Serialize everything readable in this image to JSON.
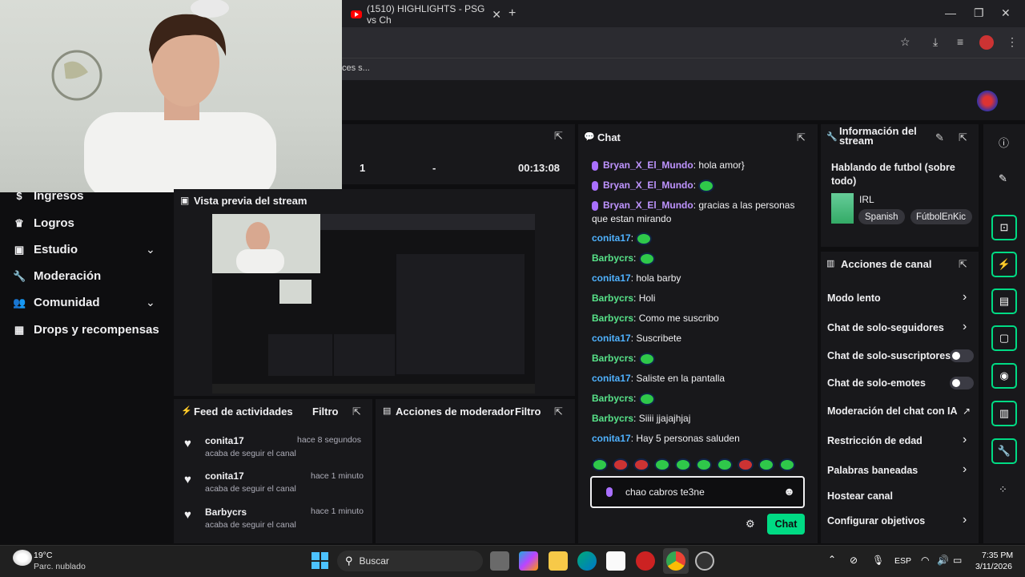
{
  "browser": {
    "tab_title": "(1510) HIGHLIGHTS - PSG vs Ch",
    "bookmarks_partial": "ces s..."
  },
  "stats": {
    "viewers": "1",
    "followers": "-",
    "uptime": "00:13:08"
  },
  "sidebar": {
    "items": [
      {
        "label": "Ingresos",
        "icon": "dollar-icon"
      },
      {
        "label": "Logros",
        "icon": "trophy-icon"
      },
      {
        "label": "Estudio",
        "icon": "film-icon",
        "expandable": true
      },
      {
        "label": "Moderación",
        "icon": "wrench-icon"
      },
      {
        "label": "Comunidad",
        "icon": "people-icon",
        "expandable": true
      },
      {
        "label": "Drops y recompensas",
        "icon": "gift-icon"
      }
    ]
  },
  "preview": {
    "title": "Vista previa del stream"
  },
  "feed": {
    "title": "Feed de actividades",
    "filter_label": "Filtro",
    "items": [
      {
        "user": "conita17",
        "time": "hace 8 segundos",
        "action": "acaba de seguir el canal"
      },
      {
        "user": "conita17",
        "time": "hace 1 minuto",
        "action": "acaba de seguir el canal"
      },
      {
        "user": "Barbycrs",
        "time": "hace 1 minuto",
        "action": "acaba de seguir el canal"
      }
    ]
  },
  "modactions": {
    "title": "Acciones de moderador",
    "filter_label": "Filtro"
  },
  "chat": {
    "title": "Chat",
    "messages": [
      {
        "user": "Bryan_X_El_Mundo",
        "text": "hola amor}",
        "cls": "u1",
        "badge": true
      },
      {
        "user": "Bryan_X_El_Mundo",
        "text": "",
        "cls": "u1",
        "badge": true,
        "emote": true
      },
      {
        "user": "Bryan_X_El_Mundo",
        "text": "gracias a las personas que estan mirando",
        "cls": "u1",
        "badge": true
      },
      {
        "user": "conita17",
        "text": "",
        "cls": "u2",
        "emote": true
      },
      {
        "user": "Barbycrs",
        "text": "",
        "cls": "u3",
        "emote": true
      },
      {
        "user": "conita17",
        "text": "hola barby",
        "cls": "u2"
      },
      {
        "user": "Barbycrs",
        "text": "Holi",
        "cls": "u3"
      },
      {
        "user": "Barbycrs",
        "text": "Como me suscribo",
        "cls": "u3"
      },
      {
        "user": "conita17",
        "text": "Suscribete",
        "cls": "u2"
      },
      {
        "user": "Barbycrs",
        "text": "",
        "cls": "u3",
        "emote": true
      },
      {
        "user": "conita17",
        "text": "Saliste en la pantalla",
        "cls": "u2"
      },
      {
        "user": "Barbycrs",
        "text": "",
        "cls": "u3",
        "emote": true
      },
      {
        "user": "Barbycrs",
        "text": "Siiii jjajajhjaj",
        "cls": "u3"
      },
      {
        "user": "conita17",
        "text": "Hay 5 personas saluden",
        "cls": "u2"
      }
    ],
    "input_value": "chao cabros te3ne",
    "send_label": "Chat"
  },
  "info": {
    "title": "Información del stream",
    "stream_title": "Hablando de futbol (sobre todo)",
    "category": "IRL",
    "tags": [
      "Spanish",
      "FútbolEnKic"
    ]
  },
  "channel_actions": {
    "title": "Acciones de canal",
    "items": [
      {
        "label": "Modo lento",
        "kind": "arrow"
      },
      {
        "label": "Chat de solo-seguidores",
        "kind": "arrow"
      },
      {
        "label": "Chat de solo-suscriptores",
        "kind": "toggle"
      },
      {
        "label": "Chat de solo-emotes",
        "kind": "toggle"
      },
      {
        "label": "Moderación del chat con IA",
        "kind": "external"
      },
      {
        "label": "Restricción de edad",
        "kind": "arrow"
      },
      {
        "label": "Palabras baneadas",
        "kind": "arrow"
      },
      {
        "label": "Hostear canal",
        "kind": "none"
      },
      {
        "label": "Configurar objetivos",
        "kind": "arrow"
      }
    ]
  },
  "taskbar": {
    "weather_temp": "19°C",
    "weather_desc": "Parc. nublado",
    "search_label": "Buscar",
    "lang": "ESP",
    "time": "7:35 PM",
    "date": "3/11/2026"
  },
  "colors": {
    "accent": "#00db84",
    "twitch_purple": "#a970ff",
    "bg": "#0e0e10",
    "panel": "#18181b"
  }
}
